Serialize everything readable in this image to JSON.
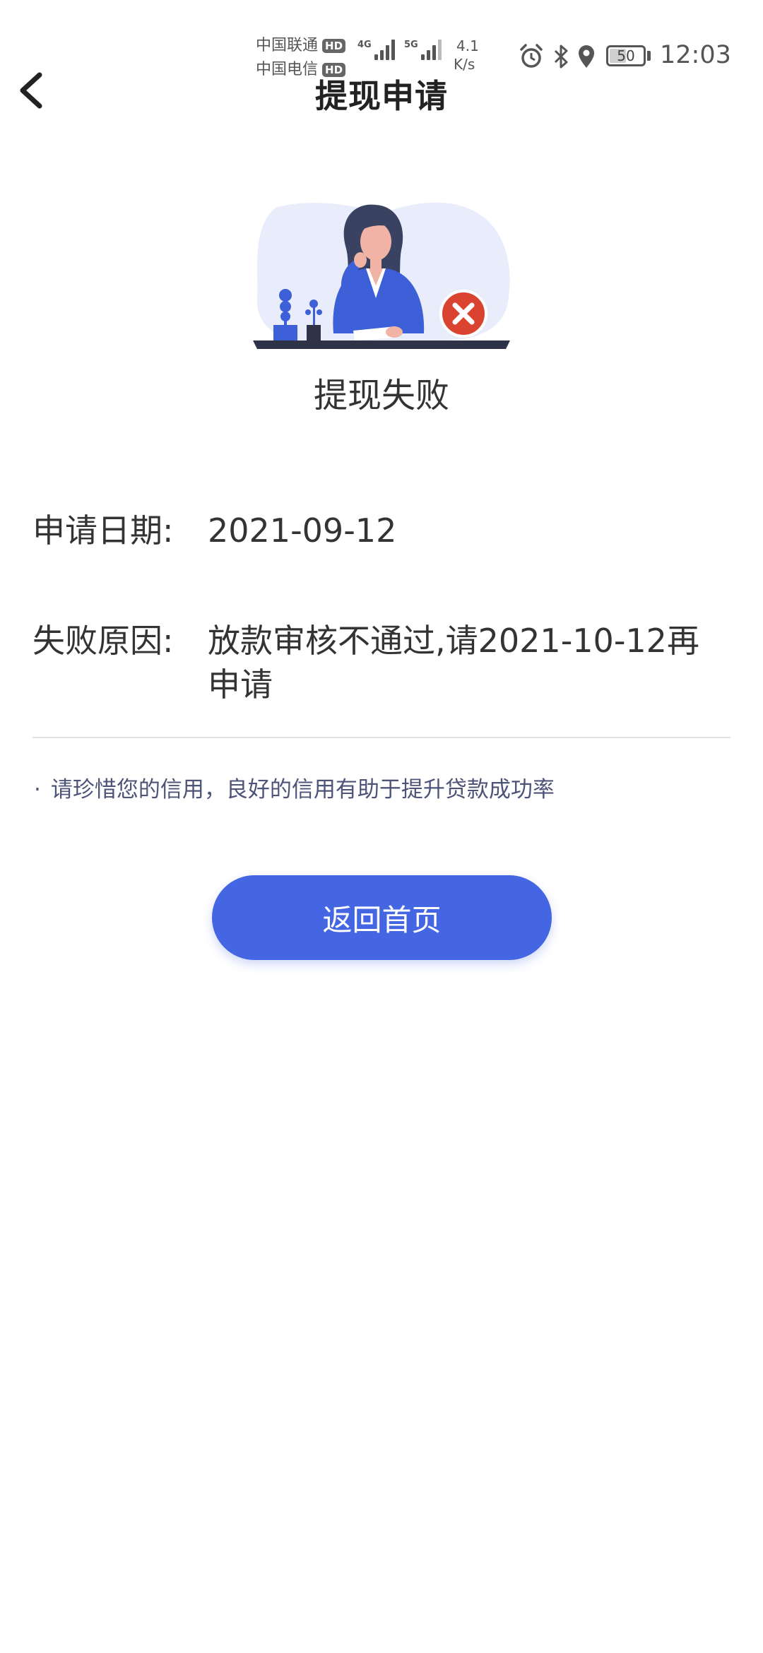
{
  "status_bar": {
    "carrier_1": "中国联通",
    "carrier_2": "中国电信",
    "hd_badge": "HD",
    "net_type_1": "4G",
    "net_type_2": "5G",
    "net_speed_value": "4.1",
    "net_speed_unit": "K/s",
    "battery_level": "50",
    "time": "12:03",
    "icons": [
      "alarm-icon",
      "bluetooth-icon",
      "location-icon",
      "battery-icon"
    ]
  },
  "header": {
    "title": "提现申请",
    "back_icon": "chevron-left-icon"
  },
  "result": {
    "status_text": "提现失败",
    "status_icon": "error-x-icon",
    "accent_color": "#4466e3",
    "error_color": "#d9432f"
  },
  "details": {
    "apply_date_label": "申请日期:",
    "apply_date_value": "2021-09-12",
    "reason_label": "失败原因:",
    "reason_value": "放款审核不通过,请2021-10-12再申请"
  },
  "tip": {
    "bullet": "·",
    "text": "请珍惜您的信用，良好的信用有助于提升贷款成功率"
  },
  "actions": {
    "home_button_label": "返回首页"
  }
}
